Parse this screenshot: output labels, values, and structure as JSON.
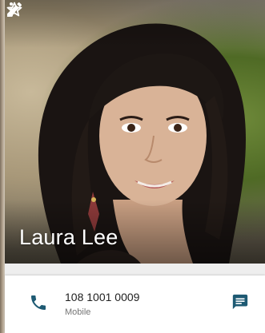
{
  "contact": {
    "name": "Laura Lee",
    "photo": "contact-photo"
  },
  "toolbar": {
    "favorite_icon": "star-outline-icon",
    "edit_icon": "pencil-icon",
    "overflow_icon": "more-vert-icon"
  },
  "phone_entry": {
    "number": "108 1001 0009",
    "type": "Mobile",
    "call_icon": "phone-icon",
    "message_icon": "message-icon"
  },
  "colors": {
    "accent": "#1e5a73",
    "text_primary": "#212121",
    "text_secondary": "#757575",
    "card_background": "#ffffff",
    "page_background": "#eeeeee"
  }
}
